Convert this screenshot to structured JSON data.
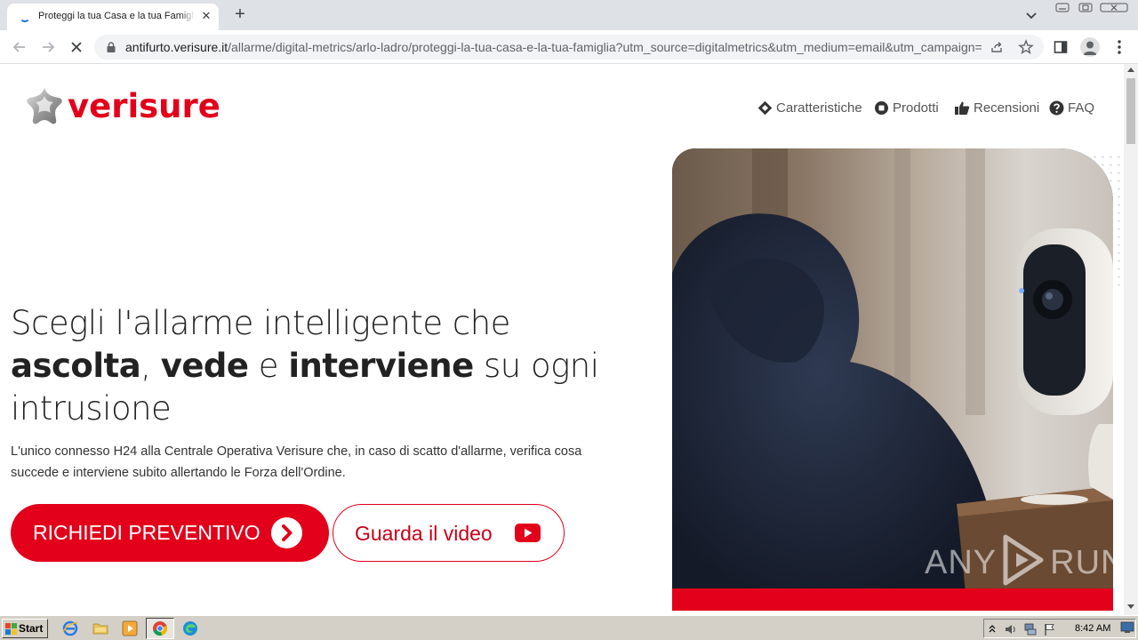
{
  "browser": {
    "tab_title": "Proteggi la tua Casa e la tua Famiglia",
    "tab_close": "✕",
    "new_tab": "+",
    "url_host": "antifurto.verisure.it",
    "url_path": "/allarme/digital-metrics/arlo-ladro/proteggi-la-tua-casa-e-la-tua-famiglia?utm_source=digitalmetrics&utm_medium=email&utm_campaign=..."
  },
  "site": {
    "logo_text": "verisure",
    "nav": [
      {
        "label": "Caratteristiche",
        "icon": "target-icon"
      },
      {
        "label": "Prodotti",
        "icon": "circle-dot-icon"
      },
      {
        "label": "Recensioni",
        "icon": "thumbs-up-icon"
      },
      {
        "label": "FAQ",
        "icon": "question-circle-icon"
      }
    ],
    "headline": {
      "line1": "Scegli l'allarme intelligente che",
      "w1": "ascolta",
      "s1": ", ",
      "w2": "vede",
      "s2": " e ",
      "w3": "interviene",
      "s3": " su ogni",
      "line3": "intrusione"
    },
    "subtext": "L'unico connesso H24 alla Centrale Operativa Verisure che, in caso di scatto d'allarme, verifica cosa succede e interviene subito allertando le Forza dell'Ordine.",
    "cta_label": "RICHIEDI PREVENTIVO",
    "video_label": "Guarda il video",
    "brand_color": "#e2001a",
    "hero_image": "burglar-with-security-camera-photo"
  },
  "watermark": {
    "left": "ANY",
    "right": "RUN"
  },
  "taskbar": {
    "start_label": "Start",
    "clock": "8:42 AM",
    "apps": [
      "ie-icon",
      "explorer-folder-icon",
      "media-player-icon",
      "chrome-icon",
      "edge-icon"
    ]
  }
}
